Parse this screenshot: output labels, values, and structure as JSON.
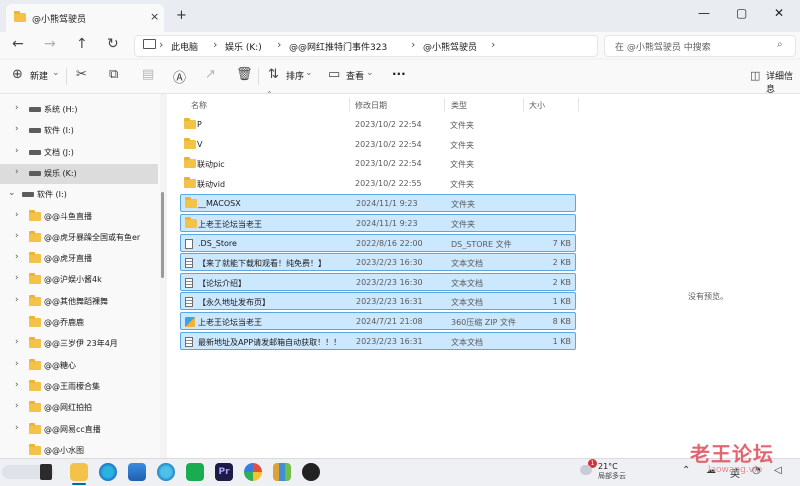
{
  "tab": {
    "title": "@小熊驾驶员",
    "close": "×",
    "new": "+"
  },
  "window": {
    "minimize": "—",
    "maximize": "▢",
    "close": "✕"
  },
  "nav": {
    "back": "←",
    "forward": "→",
    "up": "↑",
    "refresh": "↻"
  },
  "breadcrumb": [
    "此电脑",
    "娱乐 (K:)",
    "@@网红推特门事件323",
    "@小熊驾驶员"
  ],
  "search": {
    "placeholder": "在 @小熊驾驶员 中搜索"
  },
  "toolbar": {
    "new_label": "新建",
    "sort_label": "排序",
    "view_label": "查看",
    "more_label": "···",
    "details_label": "详细信息"
  },
  "sidebar": {
    "items": [
      {
        "label": "系统 (H:)",
        "type": "drive",
        "chevron": "›"
      },
      {
        "label": "软件 (I:)",
        "type": "drive",
        "chevron": "›"
      },
      {
        "label": "文档 (J:)",
        "type": "drive",
        "chevron": "›"
      },
      {
        "label": "娱乐 (K:)",
        "type": "drive",
        "chevron": "›",
        "selected": true
      },
      {
        "label": "软件 (I:)",
        "type": "drive",
        "chevron": "⌄",
        "top": true
      },
      {
        "label": "@@斗鱼直播",
        "type": "folder",
        "chevron": "›"
      },
      {
        "label": "@@虎牙暴躁全国或有鱼er",
        "type": "folder",
        "chevron": "›"
      },
      {
        "label": "@@虎牙直播",
        "type": "folder",
        "chevron": "›"
      },
      {
        "label": "@@沪娱小酱4k",
        "type": "folder",
        "chevron": "›"
      },
      {
        "label": "@@其他舞蹈裸舞",
        "type": "folder",
        "chevron": "›"
      },
      {
        "label": "@@乔鹿鹿",
        "type": "folder",
        "chevron": ""
      },
      {
        "label": "@@三岁伊 23年4月",
        "type": "folder",
        "chevron": "›"
      },
      {
        "label": "@@糖心",
        "type": "folder",
        "chevron": "›"
      },
      {
        "label": "@@王雨檬合集",
        "type": "folder",
        "chevron": "›"
      },
      {
        "label": "@@网红拍拍",
        "type": "folder",
        "chevron": "›"
      },
      {
        "label": "@@网易cc直播",
        "type": "folder",
        "chevron": "›"
      },
      {
        "label": "@@小水图",
        "type": "folder",
        "chevron": ""
      }
    ]
  },
  "columns": {
    "name": "名称",
    "date": "修改日期",
    "type": "类型",
    "size": "大小"
  },
  "files": [
    {
      "name": "P",
      "date": "2023/10/2 22:54",
      "type": "文件夹",
      "size": "",
      "icon": "folder",
      "selected": false
    },
    {
      "name": "V",
      "date": "2023/10/2 22:54",
      "type": "文件夹",
      "size": "",
      "icon": "folder",
      "selected": false
    },
    {
      "name": "联动pic",
      "date": "2023/10/2 22:54",
      "type": "文件夹",
      "size": "",
      "icon": "folder",
      "selected": false
    },
    {
      "name": "联动vid",
      "date": "2023/10/2 22:55",
      "type": "文件夹",
      "size": "",
      "icon": "folder",
      "selected": false
    },
    {
      "name": "__MACOSX",
      "date": "2024/11/1 9:23",
      "type": "文件夹",
      "size": "",
      "icon": "folder",
      "selected": true
    },
    {
      "name": "上老王论坛当老王",
      "date": "2024/11/1 9:23",
      "type": "文件夹",
      "size": "",
      "icon": "folder",
      "selected": true
    },
    {
      "name": ".DS_Store",
      "date": "2022/8/16 22:00",
      "type": "DS_STORE 文件",
      "size": "7 KB",
      "icon": "doc",
      "selected": true
    },
    {
      "name": "【来了就能下载和观看！纯免费！】",
      "date": "2023/2/23 16:30",
      "type": "文本文档",
      "size": "2 KB",
      "icon": "text",
      "selected": true
    },
    {
      "name": "【论坛介绍】",
      "date": "2023/2/23 16:30",
      "type": "文本文档",
      "size": "2 KB",
      "icon": "text",
      "selected": true
    },
    {
      "name": "【永久地址发布页】",
      "date": "2023/2/23 16:31",
      "type": "文本文档",
      "size": "1 KB",
      "icon": "text",
      "selected": true
    },
    {
      "name": "上老王论坛当老王",
      "date": "2024/7/21 21:08",
      "type": "360压缩 ZIP 文件",
      "size": "8 KB",
      "icon": "zip",
      "selected": true
    },
    {
      "name": "最新地址及APP请发邮箱自动获取！！！",
      "date": "2023/2/23 16:31",
      "type": "文本文档",
      "size": "1 KB",
      "icon": "text",
      "selected": true
    }
  ],
  "preview": {
    "empty_text": "没有预览。"
  },
  "taskbar": {
    "weather_temp": "21°C",
    "weather_desc": "局部多云",
    "notification_count": "1"
  },
  "watermark": {
    "title": "老王论坛",
    "url": "laowang.vip"
  },
  "colors": {
    "selection_bg": "#cce8ff",
    "selection_border": "#5aa7e6",
    "folder": "#f3c348",
    "accent": "#0067c0"
  }
}
